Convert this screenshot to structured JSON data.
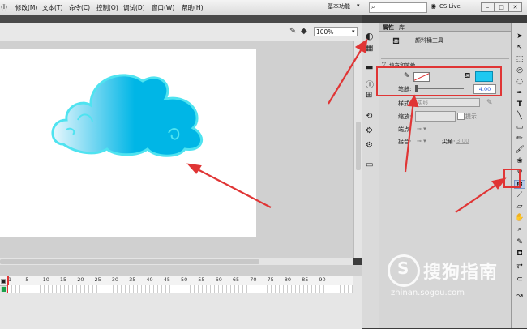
{
  "menu": {
    "items": [
      "(I)",
      "修改(M)",
      "文本(T)",
      "命令(C)",
      "控制(O)",
      "调试(D)",
      "窗口(W)",
      "帮助(H)"
    ],
    "workspace": "基本功能",
    "cs_live": "CS Live"
  },
  "doc_toolbar": {
    "zoom": "100%"
  },
  "properties": {
    "tabs": [
      "属性",
      "库"
    ],
    "tool_name": "颜料桶工具",
    "section_fill_stroke": "填充和笔触",
    "stroke_label": "笔触:",
    "stroke_value": "4.00",
    "style_label": "样式:",
    "style_value": "实线",
    "scale_label": "缩放:",
    "hint_label": "提示",
    "cap_label": "端点:",
    "join_label": "接合:",
    "miter_label": "尖角:",
    "miter_value": "3.00"
  },
  "timeline": {
    "frame_numbers": [
      "1",
      "5",
      "10",
      "15",
      "20",
      "25",
      "30",
      "35",
      "40",
      "45",
      "50",
      "55",
      "60",
      "65",
      "70",
      "75",
      "80",
      "85",
      "90"
    ]
  },
  "colors": {
    "fill": "#1ec8f0",
    "stroke_none": "#e03535",
    "highlight": "#e03535",
    "cloud_light": "#e8f7fd",
    "cloud_dark": "#00b6e6",
    "cloud_outline": "#4fe3f0"
  },
  "watermark": {
    "brand": "搜狗指南",
    "url": "zhinan.sogou.com"
  }
}
